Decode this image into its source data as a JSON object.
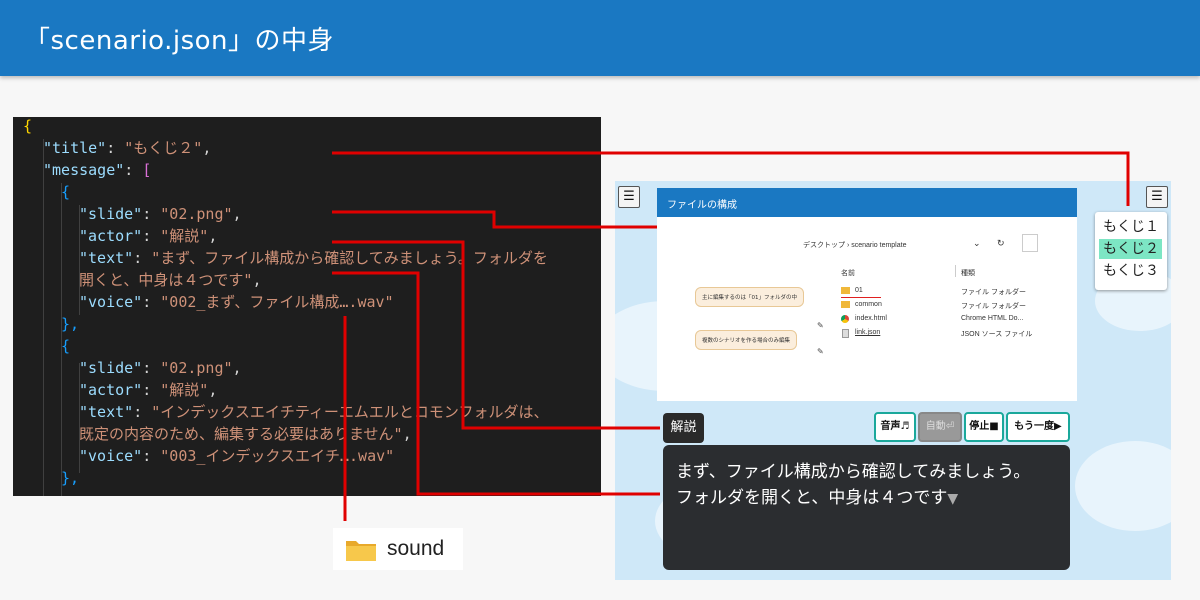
{
  "header": {
    "title": "「scenario.json」の中身"
  },
  "code": {
    "l1": "{",
    "l2_key": "\"title\"",
    "l2_val": "\"もくじ２\"",
    "l3_key": "\"message\"",
    "l3_br": "[",
    "l4": "{",
    "l5_key": "\"slide\"",
    "l5_val": "\"02.png\"",
    "l6_key": "\"actor\"",
    "l6_val": "\"解説\"",
    "l7_key": "\"text\"",
    "l7_val": "\"まず、ファイル構成から確認してみましょう。フォルダを",
    "l8_val": "開くと、中身は４つです\"",
    "l9_key": "\"voice\"",
    "l9_val": "\"002_まず、ファイル構成….wav\"",
    "l10": "},",
    "l11": "{",
    "l12_key": "\"slide\"",
    "l12_val": "\"02.png\"",
    "l13_key": "\"actor\"",
    "l13_val": "\"解説\"",
    "l14_key": "\"text\"",
    "l14_val": "\"インデックスエイチティーエムエルとコモンフォルダは、",
    "l15_val": "既定の内容のため、編集する必要はありません\"",
    "l16_key": "\"voice\"",
    "l16_val": "\"003_インデックスエイチ….wav\"",
    "l17": "},"
  },
  "sound": {
    "label": "sound",
    "icon": "folder-icon"
  },
  "game": {
    "slide_title": "ファイルの構成",
    "breadcrumb": "デスクトップ  ›  scenario template",
    "col_name": "名前",
    "col_type": "種類",
    "files": [
      {
        "name": "01",
        "type": "ファイル フォルダー"
      },
      {
        "name": "common",
        "type": "ファイル フォルダー"
      },
      {
        "name": "index.html",
        "type": "Chrome HTML Do..."
      },
      {
        "name": "link.json",
        "type": "JSON ソース ファイル"
      }
    ],
    "callout1": "主に編集するのは「01」フォルダの中",
    "callout2": "複数のシナリオを作る場合のみ編集",
    "toc": [
      "もくじ１",
      "もくじ２",
      "もくじ３"
    ],
    "actor": "解説",
    "controls": {
      "voice": "音声♬",
      "auto": "自動⏎",
      "stop": "停止■",
      "again": "もう一度▶"
    },
    "message_line1": "まず、ファイル構成から確認してみましょう。",
    "message_line2": "フォルダを開くと、中身は４つです",
    "menu_icon": "☰"
  }
}
